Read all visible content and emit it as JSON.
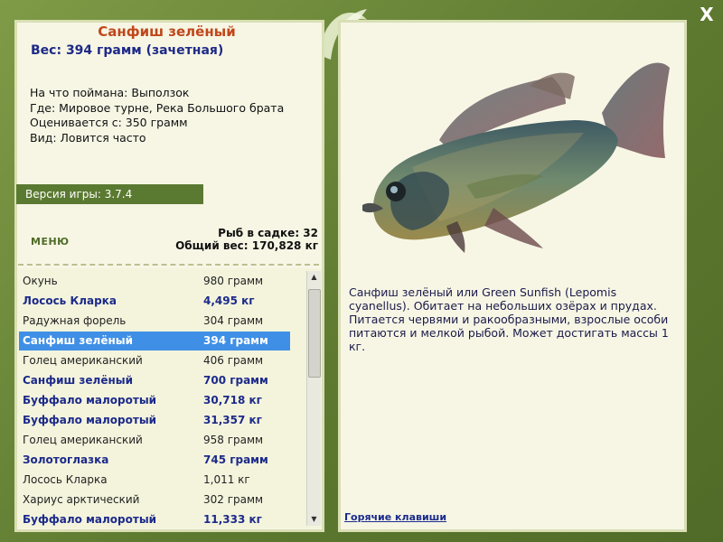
{
  "close": {
    "label": "X"
  },
  "card": {
    "title": "Санфиш зелёный",
    "weight": "Вес: 394 грамм (зачетная)",
    "lines": [
      "На что поймана: Выползок",
      "Где: Мировое турне, Река Большого брата",
      "Оценивается с: 350 грамм",
      "Вид: Ловится часто"
    ]
  },
  "version": "Версия игры: 3.7.4",
  "menu_label": "МЕНЮ",
  "keepnet": {
    "count": "Рыб в садке: 32",
    "total": "Общий вес: 170,828 кг"
  },
  "fish_list": [
    {
      "name": "Окунь",
      "weight": "980 грамм",
      "bold": false,
      "selected": false
    },
    {
      "name": "Лосось Кларка",
      "weight": "4,495 кг",
      "bold": true,
      "selected": false
    },
    {
      "name": "Радужная форель",
      "weight": "304 грамм",
      "bold": false,
      "selected": false
    },
    {
      "name": "Санфиш зелёный",
      "weight": "394 грамм",
      "bold": true,
      "selected": true
    },
    {
      "name": "Голец американский",
      "weight": "406 грамм",
      "bold": false,
      "selected": false
    },
    {
      "name": "Санфиш зелёный",
      "weight": "700 грамм",
      "bold": true,
      "selected": false
    },
    {
      "name": "Буффало малоротый",
      "weight": "30,718 кг",
      "bold": true,
      "selected": false
    },
    {
      "name": "Буффало малоротый",
      "weight": "31,357 кг",
      "bold": true,
      "selected": false
    },
    {
      "name": "Голец американский",
      "weight": "958 грамм",
      "bold": false,
      "selected": false
    },
    {
      "name": "Золотоглазка",
      "weight": "745 грамм",
      "bold": true,
      "selected": false
    },
    {
      "name": "Лосось Кларка",
      "weight": "1,011 кг",
      "bold": false,
      "selected": false
    },
    {
      "name": "Хариус арктический",
      "weight": "302 грамм",
      "bold": false,
      "selected": false
    },
    {
      "name": "Буффало малоротый",
      "weight": "11,333 кг",
      "bold": true,
      "selected": false
    }
  ],
  "description": "Санфиш зелёный или Green Sunfish (Lepomis cyanellus). Обитает на небольших озёрах и прудах. Питается червями и ракообразными, взрослые особи питаются и мелкой рыбой. Может достигать массы 1 кг.",
  "hotkeys_label": "Горячие клавиши",
  "colors": {
    "accent_green": "#5b7a31",
    "title": "#c0471b",
    "bold_text": "#1c2a8a",
    "selection": "#3f8fe6"
  }
}
